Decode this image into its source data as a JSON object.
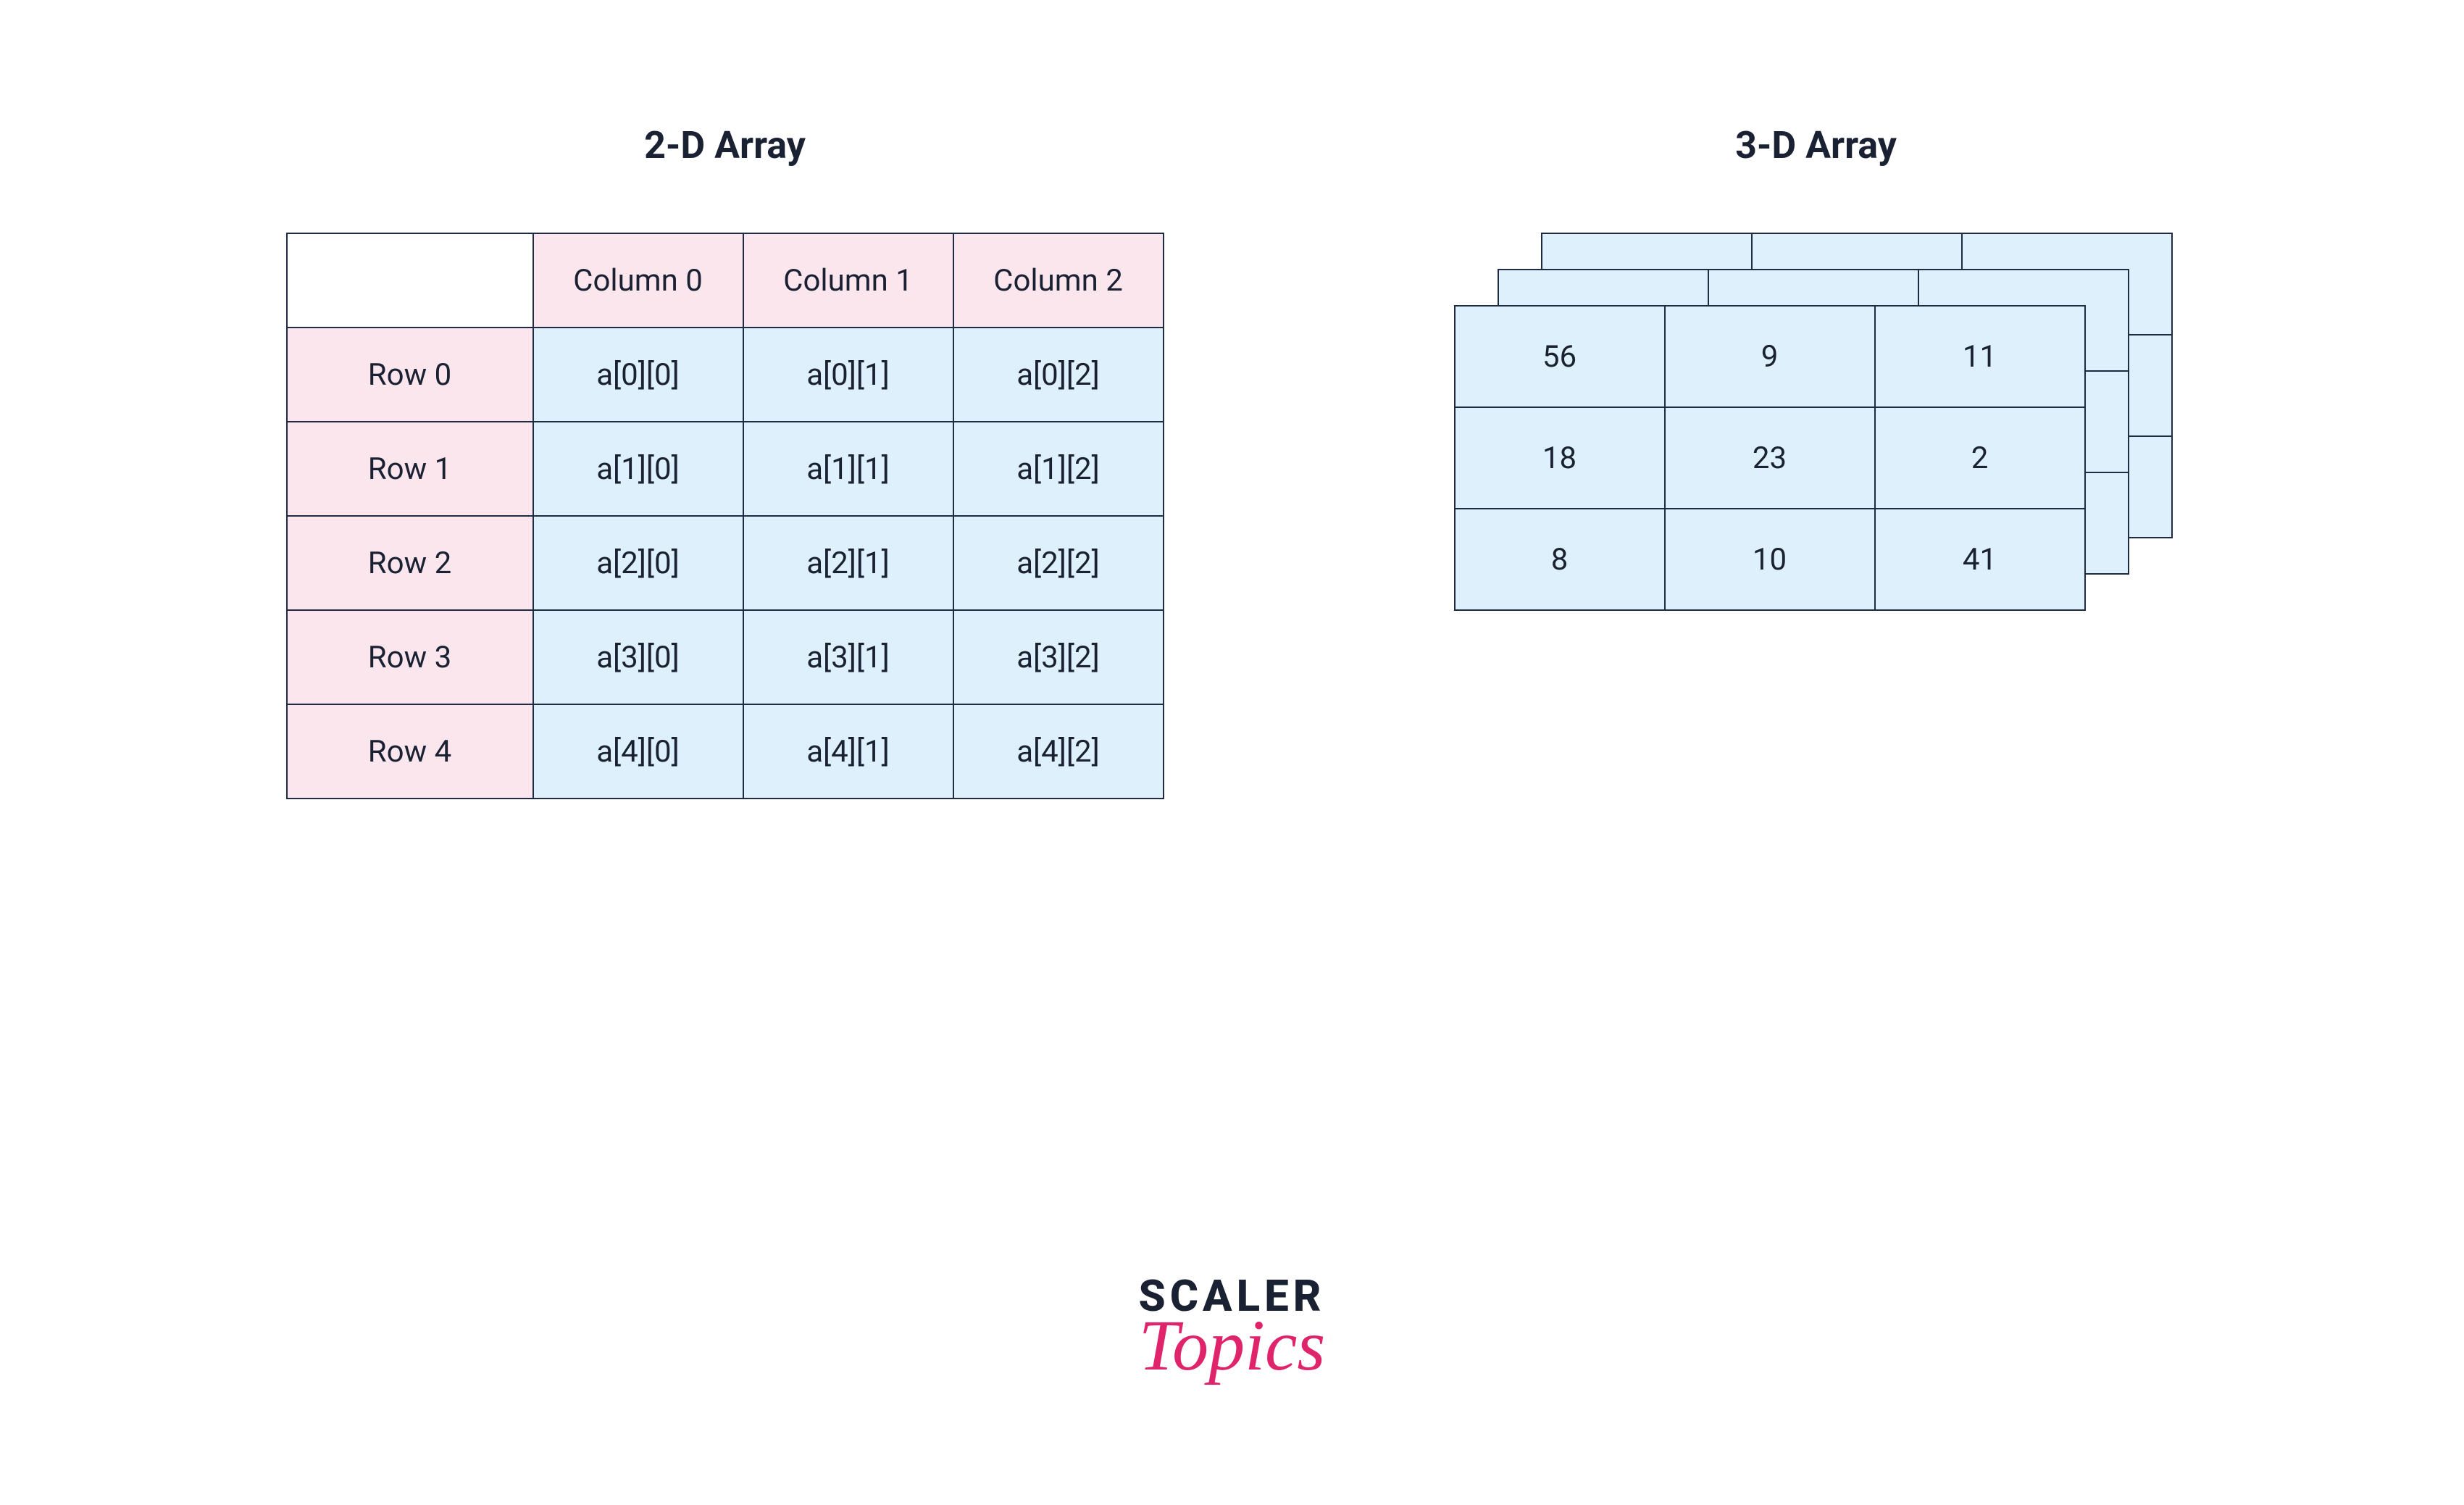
{
  "titles": {
    "two_d": "2-D Array",
    "three_d": "3-D Array"
  },
  "table2d": {
    "corner": "",
    "col_headers": [
      "Column 0",
      "Column 1",
      "Column 2"
    ],
    "row_headers": [
      "Row 0",
      "Row 1",
      "Row 2",
      "Row 3",
      "Row 4"
    ],
    "cells": [
      [
        "a[0][0]",
        "a[0][1]",
        "a[0][2]"
      ],
      [
        "a[1][0]",
        "a[1][1]",
        "a[1][2]"
      ],
      [
        "a[2][0]",
        "a[2][1]",
        "a[2][2]"
      ],
      [
        "a[3][0]",
        "a[3][1]",
        "a[3][2]"
      ],
      [
        "a[4][0]",
        "a[4][1]",
        "a[4][2]"
      ]
    ]
  },
  "table3d": {
    "front": [
      [
        "56",
        "9",
        "11"
      ],
      [
        "18",
        "23",
        "2"
      ],
      [
        "8",
        "10",
        "41"
      ]
    ]
  },
  "logo": {
    "top": "SCALER",
    "bottom": "Topics"
  },
  "colors": {
    "border": "#1f2a44",
    "pink": "#fce6ed",
    "blue": "#def0fb",
    "accent": "#e0246b",
    "text": "#1a2133"
  }
}
